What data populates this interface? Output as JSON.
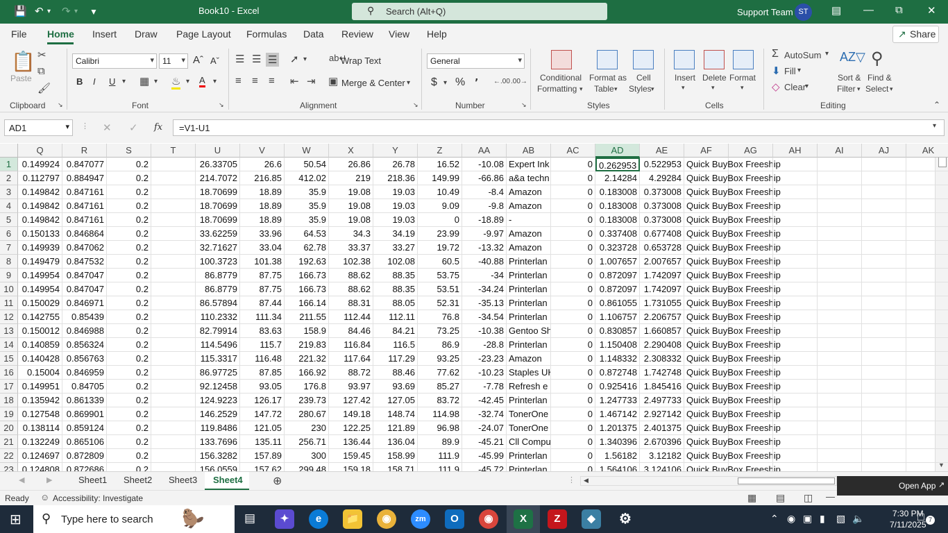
{
  "title_bar": {
    "doc_title": "Book10  -  Excel",
    "search_placeholder": "Search (Alt+Q)",
    "user_name": "Support Team",
    "user_initials": "ST"
  },
  "ribbon_tabs": [
    "File",
    "Home",
    "Insert",
    "Draw",
    "Page Layout",
    "Formulas",
    "Data",
    "Review",
    "View",
    "Help"
  ],
  "share_label": "Share",
  "ribbon": {
    "clipboard": {
      "paste": "Paste",
      "label": "Clipboard"
    },
    "font": {
      "name": "Calibri",
      "size": "11",
      "label": "Font"
    },
    "alignment": {
      "wrap": "Wrap Text",
      "merge": "Merge & Center",
      "label": "Alignment"
    },
    "number": {
      "format": "General",
      "label": "Number"
    },
    "styles": {
      "conditional1": "Conditional",
      "conditional2": "Formatting",
      "format_table1": "Format as",
      "format_table2": "Table",
      "cell_styles1": "Cell",
      "cell_styles2": "Styles",
      "label": "Styles"
    },
    "cells": {
      "insert": "Insert",
      "delete": "Delete",
      "format": "Format",
      "label": "Cells"
    },
    "editing": {
      "autosum": "AutoSum",
      "fill": "Fill",
      "clear": "Clear",
      "sort1": "Sort &",
      "sort2": "Filter",
      "find1": "Find &",
      "find2": "Select",
      "label": "Editing"
    }
  },
  "formula_bar": {
    "name_box": "AD1",
    "fx": "fx",
    "formula": "=V1-U1"
  },
  "columns": [
    "Q",
    "R",
    "S",
    "T",
    "U",
    "V",
    "W",
    "X",
    "Y",
    "Z",
    "AA",
    "AB",
    "AC",
    "AD",
    "AE",
    "AF",
    "AG",
    "AH",
    "AI",
    "AJ",
    "AK"
  ],
  "selected_cell": {
    "column": "AD",
    "row": "1"
  },
  "rows": [
    {
      "n": "1",
      "c": [
        "0.149924",
        "0.847077",
        "0.2",
        "",
        "26.33705",
        "26.6",
        "50.54",
        "26.86",
        "26.78",
        "16.52",
        "-10.08",
        "Expert Ink",
        "0",
        "0.262953",
        "0.522953",
        "Quick BuyBox Freeship"
      ]
    },
    {
      "n": "2",
      "c": [
        "0.112797",
        "0.884947",
        "0.2",
        "",
        "214.7072",
        "216.85",
        "412.02",
        "219",
        "218.36",
        "149.99",
        "-66.86",
        "a&a techn",
        "0",
        "2.14284",
        "4.29284",
        "Quick BuyBox Freeship"
      ]
    },
    {
      "n": "3",
      "c": [
        "0.149842",
        "0.847161",
        "0.2",
        "",
        "18.70699",
        "18.89",
        "35.9",
        "19.08",
        "19.03",
        "10.49",
        "-8.4",
        "Amazon",
        "0",
        "0.183008",
        "0.373008",
        "Quick BuyBox Freeship"
      ]
    },
    {
      "n": "4",
      "c": [
        "0.149842",
        "0.847161",
        "0.2",
        "",
        "18.70699",
        "18.89",
        "35.9",
        "19.08",
        "19.03",
        "9.09",
        "-9.8",
        "Amazon",
        "0",
        "0.183008",
        "0.373008",
        "Quick BuyBox Freeship"
      ]
    },
    {
      "n": "5",
      "c": [
        "0.149842",
        "0.847161",
        "0.2",
        "",
        "18.70699",
        "18.89",
        "35.9",
        "19.08",
        "19.03",
        "0",
        "-18.89",
        "-",
        "0",
        "0.183008",
        "0.373008",
        "Quick BuyBox Freeship"
      ]
    },
    {
      "n": "6",
      "c": [
        "0.150133",
        "0.846864",
        "0.2",
        "",
        "33.62259",
        "33.96",
        "64.53",
        "34.3",
        "34.19",
        "23.99",
        "-9.97",
        "Amazon",
        "0",
        "0.337408",
        "0.677408",
        "Quick BuyBox Freeship"
      ]
    },
    {
      "n": "7",
      "c": [
        "0.149939",
        "0.847062",
        "0.2",
        "",
        "32.71627",
        "33.04",
        "62.78",
        "33.37",
        "33.27",
        "19.72",
        "-13.32",
        "Amazon",
        "0",
        "0.323728",
        "0.653728",
        "Quick BuyBox Freeship"
      ]
    },
    {
      "n": "8",
      "c": [
        "0.149479",
        "0.847532",
        "0.2",
        "",
        "100.3723",
        "101.38",
        "192.63",
        "102.38",
        "102.08",
        "60.5",
        "-40.88",
        "Printerlan",
        "0",
        "1.007657",
        "2.007657",
        "Quick BuyBox Freeship"
      ]
    },
    {
      "n": "9",
      "c": [
        "0.149954",
        "0.847047",
        "0.2",
        "",
        "86.8779",
        "87.75",
        "166.73",
        "88.62",
        "88.35",
        "53.75",
        "-34",
        "Printerlan",
        "0",
        "0.872097",
        "1.742097",
        "Quick BuyBox Freeship"
      ]
    },
    {
      "n": "10",
      "c": [
        "0.149954",
        "0.847047",
        "0.2",
        "",
        "86.8779",
        "87.75",
        "166.73",
        "88.62",
        "88.35",
        "53.51",
        "-34.24",
        "Printerlan",
        "0",
        "0.872097",
        "1.742097",
        "Quick BuyBox Freeship"
      ]
    },
    {
      "n": "11",
      "c": [
        "0.150029",
        "0.846971",
        "0.2",
        "",
        "86.57894",
        "87.44",
        "166.14",
        "88.31",
        "88.05",
        "52.31",
        "-35.13",
        "Printerlan",
        "0",
        "0.861055",
        "1.731055",
        "Quick BuyBox Freeship"
      ]
    },
    {
      "n": "12",
      "c": [
        "0.142755",
        "0.85439",
        "0.2",
        "",
        "110.2332",
        "111.34",
        "211.55",
        "112.44",
        "112.11",
        "76.8",
        "-34.54",
        "Printerlan",
        "0",
        "1.106757",
        "2.206757",
        "Quick BuyBox Freeship"
      ]
    },
    {
      "n": "13",
      "c": [
        "0.150012",
        "0.846988",
        "0.2",
        "",
        "82.79914",
        "83.63",
        "158.9",
        "84.46",
        "84.21",
        "73.25",
        "-10.38",
        "Gentoo Sh",
        "0",
        "0.830857",
        "1.660857",
        "Quick BuyBox Freeship"
      ]
    },
    {
      "n": "14",
      "c": [
        "0.140859",
        "0.856324",
        "0.2",
        "",
        "114.5496",
        "115.7",
        "219.83",
        "116.84",
        "116.5",
        "86.9",
        "-28.8",
        "Printerlan",
        "0",
        "1.150408",
        "2.290408",
        "Quick BuyBox Freeship"
      ]
    },
    {
      "n": "15",
      "c": [
        "0.140428",
        "0.856763",
        "0.2",
        "",
        "115.3317",
        "116.48",
        "221.32",
        "117.64",
        "117.29",
        "93.25",
        "-23.23",
        "Amazon",
        "0",
        "1.148332",
        "2.308332",
        "Quick BuyBox Freeship"
      ]
    },
    {
      "n": "16",
      "c": [
        "0.15004",
        "0.846959",
        "0.2",
        "",
        "86.97725",
        "87.85",
        "166.92",
        "88.72",
        "88.46",
        "77.62",
        "-10.23",
        "Staples UK",
        "0",
        "0.872748",
        "1.742748",
        "Quick BuyBox Freeship"
      ]
    },
    {
      "n": "17",
      "c": [
        "0.149951",
        "0.84705",
        "0.2",
        "",
        "92.12458",
        "93.05",
        "176.8",
        "93.97",
        "93.69",
        "85.27",
        "-7.78",
        "Refresh e",
        "0",
        "0.925416",
        "1.845416",
        "Quick BuyBox Freeship"
      ]
    },
    {
      "n": "18",
      "c": [
        "0.135942",
        "0.861339",
        "0.2",
        "",
        "124.9223",
        "126.17",
        "239.73",
        "127.42",
        "127.05",
        "83.72",
        "-42.45",
        "Printerlan",
        "0",
        "1.247733",
        "2.497733",
        "Quick BuyBox Freeship"
      ]
    },
    {
      "n": "19",
      "c": [
        "0.127548",
        "0.869901",
        "0.2",
        "",
        "146.2529",
        "147.72",
        "280.67",
        "149.18",
        "148.74",
        "114.98",
        "-32.74",
        "TonerOne",
        "0",
        "1.467142",
        "2.927142",
        "Quick BuyBox Freeship"
      ]
    },
    {
      "n": "20",
      "c": [
        "0.138114",
        "0.859124",
        "0.2",
        "",
        "119.8486",
        "121.05",
        "230",
        "122.25",
        "121.89",
        "96.98",
        "-24.07",
        "TonerOne",
        "0",
        "1.201375",
        "2.401375",
        "Quick BuyBox Freeship"
      ]
    },
    {
      "n": "21",
      "c": [
        "0.132249",
        "0.865106",
        "0.2",
        "",
        "133.7696",
        "135.11",
        "256.71",
        "136.44",
        "136.04",
        "89.9",
        "-45.21",
        "Cll Compu",
        "0",
        "1.340396",
        "2.670396",
        "Quick BuyBox Freeship"
      ]
    },
    {
      "n": "22",
      "c": [
        "0.124697",
        "0.872809",
        "0.2",
        "",
        "156.3282",
        "157.89",
        "300",
        "159.45",
        "158.99",
        "111.9",
        "-45.99",
        "Printerlan",
        "0",
        "1.56182",
        "3.12182",
        "Quick BuyBox Freeship"
      ]
    },
    {
      "n": "23",
      "c": [
        "0.124808",
        "0.872686",
        "0.2",
        "",
        "156.0559",
        "157.62",
        "299.48",
        "159.18",
        "158.71",
        "111.9",
        "-45.72",
        "Printerlan",
        "0",
        "1.564106",
        "3.124106",
        "Quick BuyBox Freeship"
      ]
    }
  ],
  "sheets": [
    "Sheet1",
    "Sheet2",
    "Sheet3",
    "Sheet4"
  ],
  "active_sheet": "Sheet4",
  "status": {
    "ready": "Ready",
    "accessibility": "Accessibility: Investigate",
    "open_app": "Open App"
  },
  "taskbar": {
    "search_placeholder": "Type here to search",
    "time": "7:30 PM",
    "date": "7/11/2025",
    "notifications": "7"
  },
  "colors": {
    "excel_green": "#1e6e42",
    "taskbar": "#1e2b3a"
  }
}
